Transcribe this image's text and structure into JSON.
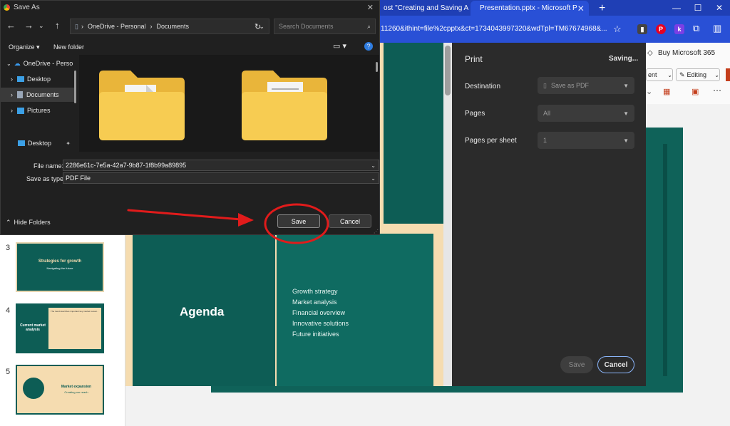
{
  "browser": {
    "tabs": [
      {
        "label": "ost \"Creating and Saving A"
      },
      {
        "label": "Presentation.pptx - Microsoft P"
      }
    ],
    "new_tab_symbol": "+",
    "address": "11260&ithint=file%2cpptx&ct=1734043997320&wdTpl=TM67674968&...",
    "extensions": [
      "P",
      "k"
    ]
  },
  "ppt": {
    "buy_label": "Buy Microsoft 365",
    "comment_label": "ent",
    "editing_label": "Editing",
    "thumbnails": [
      {
        "number": "3",
        "title": "Strategies for growth",
        "subtitle": "Navigating the future"
      },
      {
        "number": "4",
        "title": "Current market analysis",
        "body": "The trend describes important key market reveal..."
      },
      {
        "number": "5",
        "title": "Market expansion",
        "subtitle": "Creating our reach"
      }
    ],
    "slide": {
      "title": "Agenda",
      "items": [
        "Growth strategy",
        "Market analysis",
        "Financial overview",
        "Innovative solutions",
        "Future initiatives"
      ]
    }
  },
  "print_panel": {
    "title": "Print",
    "status": "Saving...",
    "destination_label": "Destination",
    "destination_value": "Save as PDF",
    "pages_label": "Pages",
    "pages_value": "All",
    "pages_per_sheet_label": "Pages per sheet",
    "pages_per_sheet_value": "1",
    "save_label": "Save",
    "cancel_label": "Cancel"
  },
  "dialog": {
    "title": "Save As",
    "breadcrumb": [
      "OneDrive - Personal",
      "Documents"
    ],
    "search_placeholder": "Search Documents",
    "organize_label": "Organize",
    "new_folder_label": "New folder",
    "nav_items": [
      "OneDrive - Perso",
      "Desktop",
      "Documents",
      "Pictures",
      "Desktop"
    ],
    "file_name_label": "File name:",
    "file_name_value": "2286e61c-7e5a-42a7-9b87-1f8b99a89895",
    "save_type_label": "Save as type:",
    "save_type_value": "PDF File",
    "hide_folders_label": "Hide Folders",
    "save_label": "Save",
    "cancel_label": "Cancel"
  },
  "colors": {
    "accent_red": "#e11b1b",
    "browser_blue": "#2950d6",
    "slide_teal": "#0d5d55",
    "slide_cream": "#f5dcb0"
  }
}
